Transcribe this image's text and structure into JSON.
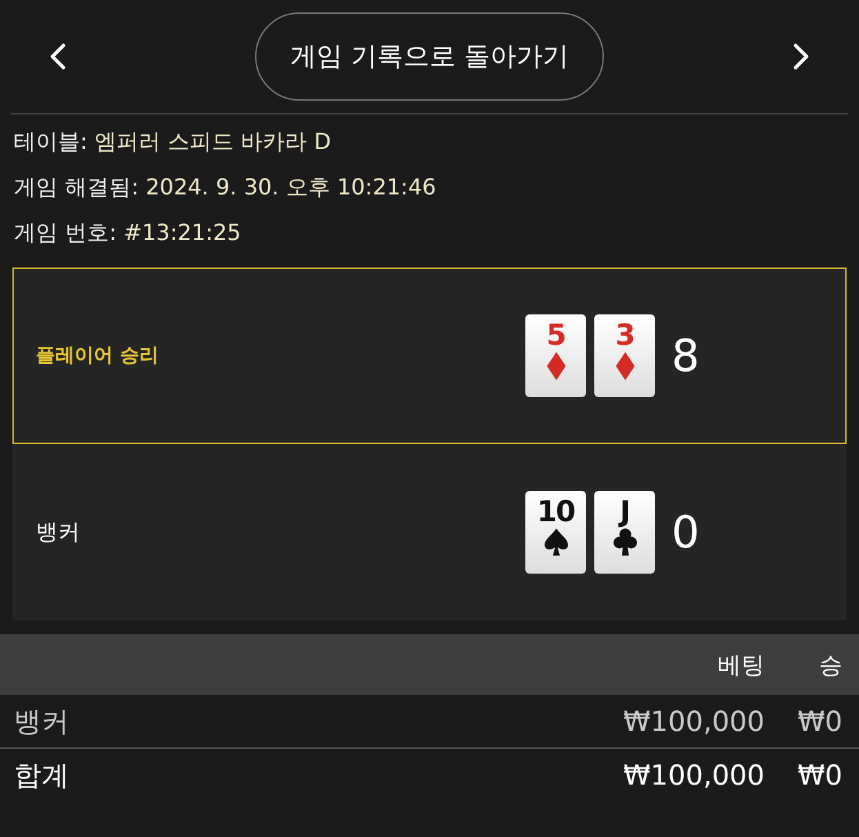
{
  "header": {
    "back_button": "게임 기록으로 돌아가기"
  },
  "info": [
    {
      "label": "테이블:",
      "value": "엠퍼러 스피드 바카라 D"
    },
    {
      "label": "게임 해결됨:",
      "value": "2024. 9. 30. 오후 10:21:46"
    },
    {
      "label": "게임 번호:",
      "value": "#13:21:25"
    }
  ],
  "hands": [
    {
      "label": "플레이어 승리",
      "winner": true,
      "cards": [
        {
          "rank": "5",
          "kind": "diamond"
        },
        {
          "rank": "3",
          "kind": "diamond"
        }
      ],
      "score": "8"
    },
    {
      "label": "뱅커",
      "winner": false,
      "cards": [
        {
          "rank": "10",
          "kind": "spade"
        },
        {
          "rank": "J",
          "kind": "club"
        }
      ],
      "score": "0"
    }
  ],
  "table": {
    "columns": [
      "베팅",
      "승"
    ],
    "rows": [
      {
        "kind": "bet",
        "name": "뱅커",
        "bet": "₩100,000",
        "win": "₩0"
      },
      {
        "kind": "total",
        "name": "합계",
        "bet": "₩100,000",
        "win": "₩0"
      }
    ]
  }
}
